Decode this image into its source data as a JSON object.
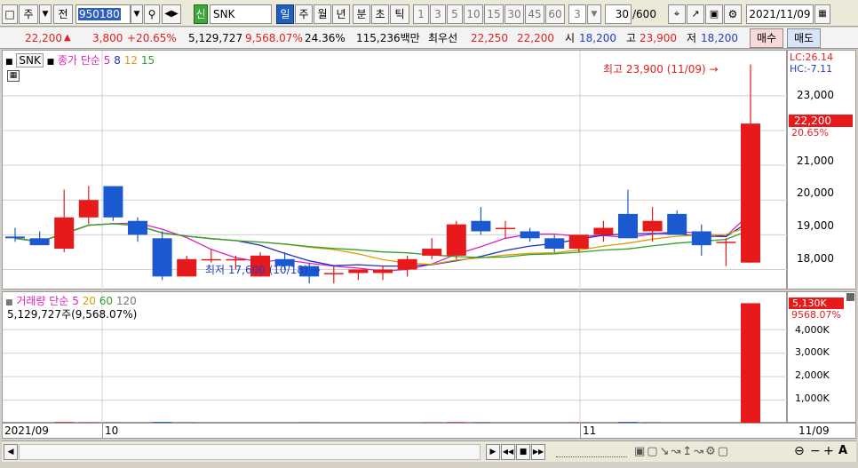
{
  "toolbar": {
    "market_type": "주",
    "prev_label": "전",
    "stock_code": "950180",
    "new_badge": "신",
    "stock_name": "SNK",
    "period_tabs": [
      "일",
      "주",
      "월",
      "년",
      "분",
      "초",
      "틱"
    ],
    "active_period": "일",
    "interval_buttons": [
      "1",
      "3",
      "5",
      "10",
      "15",
      "30",
      "45",
      "60"
    ],
    "interval_value": "3",
    "count_value": "30",
    "count_max": "/600",
    "date_value": "2021/11/09"
  },
  "quote": {
    "price": "22,200",
    "change": "3,800",
    "change_pct": "+20.65%",
    "volume": "5,129,727",
    "volume_ratio": "9,568.07%",
    "turnover": "24.36%",
    "amount": "115,236백만",
    "best_ask_label": "최우선",
    "best_ask": "22,250",
    "best_bid": "22,200",
    "open_label": "시",
    "open": "18,200",
    "high_label": "고",
    "high": "23,900",
    "low_label": "저",
    "low": "18,200",
    "buy_label": "매수",
    "sell_label": "매도"
  },
  "price_legend": {
    "symbol": "SNK",
    "indicator": "종가 단순",
    "ma_periods": [
      "5",
      "8",
      "12",
      "15"
    ]
  },
  "volume_legend": {
    "title": "거래량",
    "indicator": "단순",
    "ma_periods": [
      "5",
      "20",
      "60",
      "120"
    ],
    "summary": "5,129,727주(9,568.07%)"
  },
  "annotations": {
    "high_note": "최고 23,900 (11/09)",
    "low_note": "최저 17,600 (10/18)",
    "lc": "LC:26.14",
    "hc": "HC:-7.11",
    "current_price_tag": "22,200",
    "current_pct_tag": "20.65%",
    "vol_tag": "5,130K",
    "vol_pct_tag": "9568.07%"
  },
  "price_axis_ticks": [
    "23,000",
    "22,000",
    "21,000",
    "20,000",
    "19,000",
    "18,000"
  ],
  "volume_axis_ticks": [
    "4,000K",
    "3,000K",
    "2,000K",
    "1,000K"
  ],
  "x_axis_labels": [
    "2021/09",
    "10",
    "11",
    "11/09"
  ],
  "colors": {
    "up": "#e8191b",
    "down": "#1b59d1",
    "ma5": "#e020c0",
    "ma8": "#2030c0",
    "ma12": "#d8a000",
    "ma15": "#30a030"
  },
  "chart_data": {
    "type": "candlestick",
    "ylim": [
      17400,
      24300
    ],
    "candles": [
      {
        "o": 18950,
        "h": 19200,
        "l": 18800,
        "c": 18900
      },
      {
        "o": 18900,
        "h": 19100,
        "l": 18700,
        "c": 18700
      },
      {
        "o": 18600,
        "h": 20300,
        "l": 18500,
        "c": 19500
      },
      {
        "o": 19500,
        "h": 20400,
        "l": 19300,
        "c": 20000
      },
      {
        "o": 20400,
        "h": 20400,
        "l": 19400,
        "c": 19500
      },
      {
        "o": 19400,
        "h": 19500,
        "l": 18800,
        "c": 19000
      },
      {
        "o": 18900,
        "h": 19100,
        "l": 17700,
        "c": 17800
      },
      {
        "o": 17800,
        "h": 18400,
        "l": 17800,
        "c": 18300
      },
      {
        "o": 18300,
        "h": 18600,
        "l": 18200,
        "c": 18300
      },
      {
        "o": 18300,
        "h": 18400,
        "l": 18000,
        "c": 18300
      },
      {
        "o": 17800,
        "h": 18500,
        "l": 17800,
        "c": 18400
      },
      {
        "o": 18300,
        "h": 18500,
        "l": 18000,
        "c": 18100
      },
      {
        "o": 18100,
        "h": 18200,
        "l": 17600,
        "c": 17800
      },
      {
        "o": 17900,
        "h": 18100,
        "l": 17600,
        "c": 17900
      },
      {
        "o": 17900,
        "h": 18000,
        "l": 17700,
        "c": 18000
      },
      {
        "o": 17900,
        "h": 18100,
        "l": 17700,
        "c": 18000
      },
      {
        "o": 18000,
        "h": 18400,
        "l": 17800,
        "c": 18300
      },
      {
        "o": 18400,
        "h": 18900,
        "l": 18300,
        "c": 18600
      },
      {
        "o": 18400,
        "h": 19400,
        "l": 18300,
        "c": 19300
      },
      {
        "o": 19400,
        "h": 19800,
        "l": 19000,
        "c": 19100
      },
      {
        "o": 19200,
        "h": 19400,
        "l": 18900,
        "c": 19200
      },
      {
        "o": 19100,
        "h": 19200,
        "l": 18800,
        "c": 18900
      },
      {
        "o": 18900,
        "h": 19000,
        "l": 18500,
        "c": 18600
      },
      {
        "o": 18600,
        "h": 19000,
        "l": 18500,
        "c": 19000
      },
      {
        "o": 19000,
        "h": 19400,
        "l": 18800,
        "c": 19200
      },
      {
        "o": 19600,
        "h": 20300,
        "l": 18900,
        "c": 18900
      },
      {
        "o": 19100,
        "h": 19800,
        "l": 18800,
        "c": 19400
      },
      {
        "o": 19600,
        "h": 19700,
        "l": 19000,
        "c": 19000
      },
      {
        "o": 19100,
        "h": 19300,
        "l": 18400,
        "c": 18700
      },
      {
        "o": 18800,
        "h": 18900,
        "l": 18100,
        "c": 18800
      },
      {
        "o": 18200,
        "h": 23900,
        "l": 18200,
        "c": 22200
      }
    ],
    "volumes": [
      30,
      40,
      60,
      50,
      45,
      40,
      70,
      45,
      30,
      25,
      35,
      30,
      45,
      35,
      25,
      30,
      35,
      45,
      55,
      50,
      35,
      30,
      40,
      45,
      40,
      70,
      45,
      35,
      40,
      35,
      5130
    ]
  }
}
